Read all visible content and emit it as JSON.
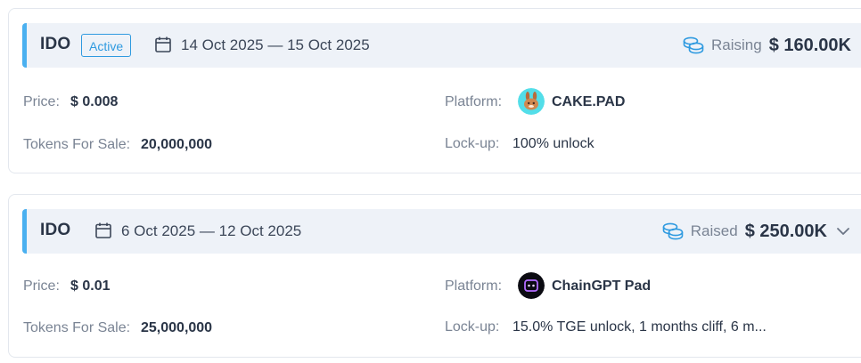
{
  "offerings": [
    {
      "type": "IDO",
      "status": "Active",
      "dates": "14 Oct 2025 — 15 Oct 2025",
      "raise_label": "Raising",
      "raise_amount": "$ 160.00K",
      "price_label": "Price:",
      "price": "$ 0.008",
      "platform_label": "Platform:",
      "platform": "CAKE.PAD",
      "platform_icon": "pancake-bunny-icon",
      "tokens_label": "Tokens For Sale:",
      "tokens": "20,000,000",
      "lockup_label": "Lock-up:",
      "lockup": "100% unlock"
    },
    {
      "type": "IDO",
      "dates": "6 Oct 2025 — 12 Oct 2025",
      "raise_label": "Raised",
      "raise_amount": "$ 250.00K",
      "price_label": "Price:",
      "price": "$ 0.01",
      "platform_label": "Platform:",
      "platform": "ChainGPT Pad",
      "platform_icon": "chaingpt-robot-icon",
      "tokens_label": "Tokens For Sale:",
      "tokens": "25,000,000",
      "lockup_label": "Lock-up:",
      "lockup": "15.0% TGE unlock, 1 months cliff, 6 m..."
    }
  ],
  "colors": {
    "accent": "#4ab0f0",
    "badge": "#2f9ae0",
    "header_bg": "#eef2f8",
    "text_dark": "#2a3547",
    "text_muted": "#7a8494"
  }
}
